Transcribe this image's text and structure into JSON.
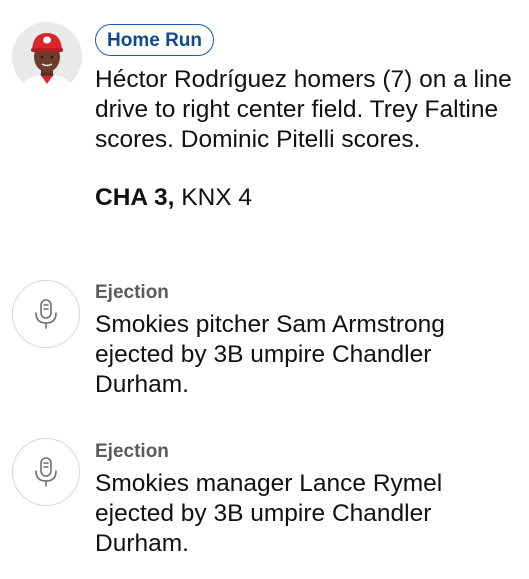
{
  "feed": {
    "home_run": {
      "badge": "Home Run",
      "description": "Héctor Rodríguez homers (7) on a line drive to right center field. Trey Faltine scores. Dominic Pitelli scores.",
      "score": {
        "team1": "CHA 3",
        "separator": ",",
        "team2": "KNX 4"
      },
      "avatar_icon": "player-headshot",
      "cap_color": "#d9262e"
    },
    "ejection_1": {
      "label": "Ejection",
      "description": "Smokies pitcher Sam Armstrong ejected by 3B umpire Chandler Durham.",
      "icon": "microphone-icon"
    },
    "ejection_2": {
      "label": "Ejection",
      "description": "Smokies manager Lance Rymel ejected by 3B umpire Chandler Durham.",
      "icon": "microphone-icon"
    }
  },
  "colors": {
    "badge_border": "#1a5db0",
    "badge_text": "#12498f",
    "label_text": "#5b5b5b",
    "icon_stroke": "#6f6f6f"
  }
}
